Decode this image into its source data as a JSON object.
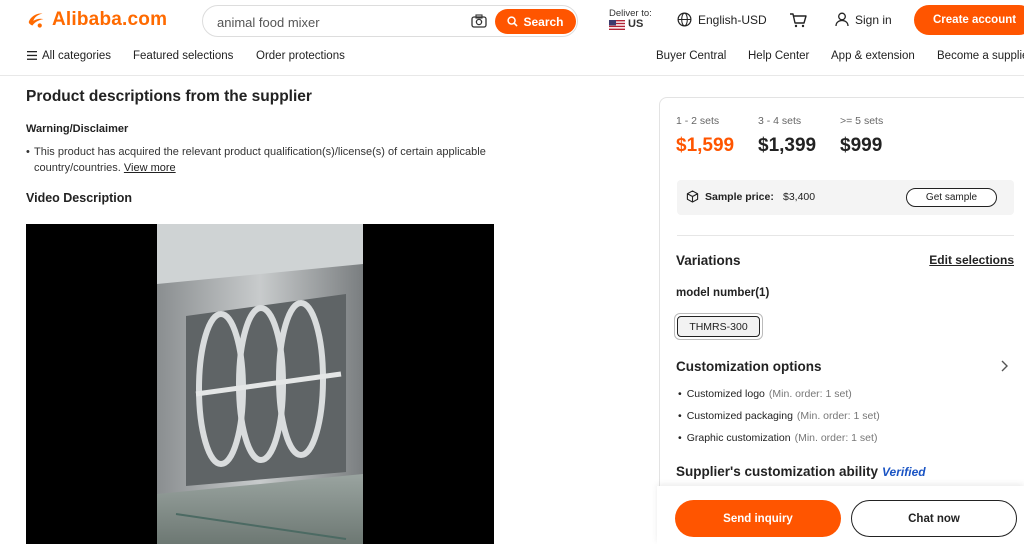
{
  "header": {
    "logo_text": "Alibaba.com",
    "search": {
      "value": "animal food mixer",
      "button_label": "Search"
    },
    "deliver": {
      "label": "Deliver to:",
      "country": "US"
    },
    "language": "English-USD",
    "sign_in": "Sign in",
    "create_account": "Create account"
  },
  "nav": {
    "all_categories": "All categories",
    "featured": "Featured selections",
    "order_protections": "Order protections",
    "buyer_central": "Buyer Central",
    "help_center": "Help Center",
    "app_extension": "App & extension",
    "become_supplier": "Become a supplier"
  },
  "main": {
    "section_title": "Product descriptions from the supplier",
    "warning_title": "Warning/Disclaimer",
    "warning_text": "This product has acquired the relevant product qualification(s)/license(s) of certain applicable country/countries.",
    "view_more": "View more",
    "video_title": "Video Description"
  },
  "pricing": {
    "tiers": [
      {
        "range": "1 - 2 sets",
        "price": "$1,599"
      },
      {
        "range": "3 - 4 sets",
        "price": "$1,399"
      },
      {
        "range": ">= 5 sets",
        "price": "$999"
      }
    ],
    "sample_label": "Sample price:",
    "sample_value": "$3,400",
    "get_sample": "Get sample"
  },
  "variations": {
    "title": "Variations",
    "edit": "Edit selections",
    "model_label": "model number(1)",
    "model_value": "THMRS-300"
  },
  "customization": {
    "title": "Customization options",
    "items": [
      {
        "name": "Customized logo",
        "min": "(Min. order: 1 set)"
      },
      {
        "name": "Customized packaging",
        "min": "(Min. order: 1 set)"
      },
      {
        "name": "Graphic customization",
        "min": "(Min. order: 1 set)"
      }
    ],
    "ability_title": "Supplier's customization ability",
    "verified": "Verified"
  },
  "actions": {
    "inquiry": "Send inquiry",
    "chat": "Chat now"
  },
  "colors": {
    "accent": "#ff5500",
    "verified": "#1a54c4"
  }
}
